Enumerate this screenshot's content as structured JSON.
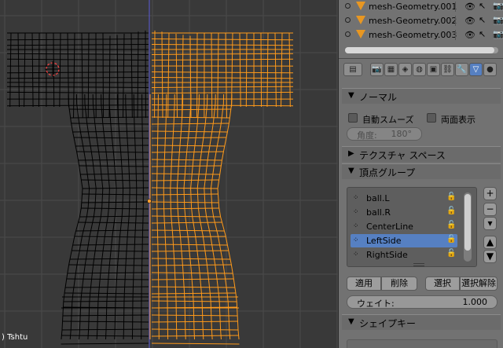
{
  "viewport": {
    "object_label": ") Tshtu",
    "wire_color_left": "#000000",
    "wire_color_right": "#ff9a1a",
    "grid_color": "#4a4a4a",
    "axis_color": "#5a5ad8"
  },
  "outliner": {
    "items": [
      {
        "name": "mesh-Geometry.001",
        "icon": "mesh-data-triangle-icon"
      },
      {
        "name": "mesh-Geometry.002",
        "icon": "mesh-data-triangle-icon"
      },
      {
        "name": "mesh-Geometry.003",
        "icon": "mesh-data-triangle-icon"
      }
    ]
  },
  "properties": {
    "normals": {
      "header": "ノーマル",
      "auto_smooth_label": "自動スムーズ",
      "double_sided_label": "両面表示",
      "angle_label": "角度:",
      "angle_value": "180°"
    },
    "texture_space": {
      "header": "テクスチャ スペース"
    },
    "vertex_groups": {
      "header": "頂点グループ",
      "items": [
        "ball.L",
        "ball.R",
        "CenterLine",
        "LeftSide",
        "RightSide"
      ],
      "selected_item": "LeftSide",
      "assign_label": "適用",
      "remove_label": "削除",
      "select_label": "選択",
      "deselect_label": "選択解除",
      "weight_label": "ウェイト:",
      "weight_value": "1.000"
    },
    "shape_keys": {
      "header": "シェイプキー"
    }
  },
  "colors": {
    "accent": "#5680c2",
    "panel_bg": "#727272",
    "viewport_bg": "#393939"
  }
}
